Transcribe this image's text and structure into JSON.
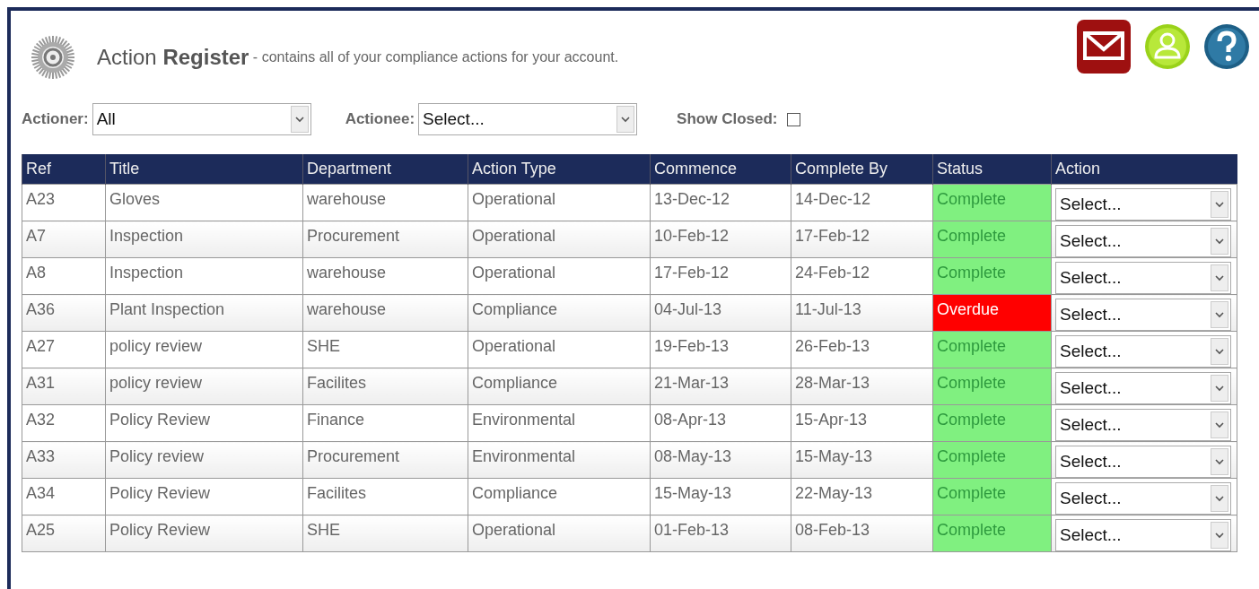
{
  "header": {
    "title_plain": "Action ",
    "title_bold": "Register",
    "subtitle": "- contains all of your compliance actions for your account."
  },
  "filters": [
    {
      "kind": "select",
      "label": "Actioner:",
      "value": "All"
    },
    {
      "kind": "select",
      "label": "Actionee:",
      "value": "Select..."
    },
    {
      "kind": "checkbox",
      "label": "Show Closed:",
      "checked": false
    }
  ],
  "table": {
    "columns": [
      "Ref",
      "Title",
      "Department",
      "Action Type",
      "Commence",
      "Complete By",
      "Status",
      "Action"
    ],
    "rows": [
      {
        "ref": "A23",
        "title": "Gloves",
        "department": "warehouse",
        "action_type": "Operational",
        "commence": "13-Dec-12",
        "complete_by": "14-Dec-12",
        "status": "Complete",
        "color": "#80f080",
        "action": "Select..."
      },
      {
        "ref": "A7",
        "title": "Inspection",
        "department": "Procurement",
        "action_type": "Operational",
        "commence": "10-Feb-12",
        "complete_by": "17-Feb-12",
        "status": "Complete",
        "color": "#80f080",
        "action": "Select..."
      },
      {
        "ref": "A8",
        "title": "Inspection",
        "department": "warehouse",
        "action_type": "Operational",
        "commence": "17-Feb-12",
        "complete_by": "24-Feb-12",
        "status": "Complete",
        "color": "#80f080",
        "action": "Select..."
      },
      {
        "ref": "A36",
        "title": "Plant Inspection",
        "department": "warehouse",
        "action_type": "Compliance",
        "commence": "04-Jul-13",
        "complete_by": "11-Jul-13",
        "status": "Overdue",
        "color": "#ff0000",
        "action": "Select..."
      },
      {
        "ref": "A27",
        "title": "policy review",
        "department": "SHE",
        "action_type": "Operational",
        "commence": "19-Feb-13",
        "complete_by": "26-Feb-13",
        "status": "Complete",
        "color": "#80f080",
        "action": "Select..."
      },
      {
        "ref": "A31",
        "title": "policy review",
        "department": "Facilites",
        "action_type": "Compliance",
        "commence": "21-Mar-13",
        "complete_by": "28-Mar-13",
        "status": "Complete",
        "color": "#80f080",
        "action": "Select..."
      },
      {
        "ref": "A32",
        "title": "Policy Review",
        "department": "Finance",
        "action_type": "Environmental",
        "commence": "08-Apr-13",
        "complete_by": "15-Apr-13",
        "status": "Complete",
        "color": "#80f080",
        "action": "Select..."
      },
      {
        "ref": "A33",
        "title": "Policy review",
        "department": "Procurement",
        "action_type": "Environmental",
        "commence": "08-May-13",
        "complete_by": "15-May-13",
        "status": "Complete",
        "color": "#80f080",
        "action": "Select..."
      },
      {
        "ref": "A34",
        "title": "Policy Review",
        "department": "Facilites",
        "action_type": "Compliance",
        "commence": "15-May-13",
        "complete_by": "22-May-13",
        "status": "Complete",
        "color": "#80f080",
        "action": "Select..."
      },
      {
        "ref": "A25",
        "title": "Policy Review",
        "department": "SHE",
        "action_type": "Operational",
        "commence": "01-Feb-13",
        "complete_by": "08-Feb-13",
        "status": "Complete",
        "color": "#80f080",
        "action": "Select..."
      }
    ]
  }
}
